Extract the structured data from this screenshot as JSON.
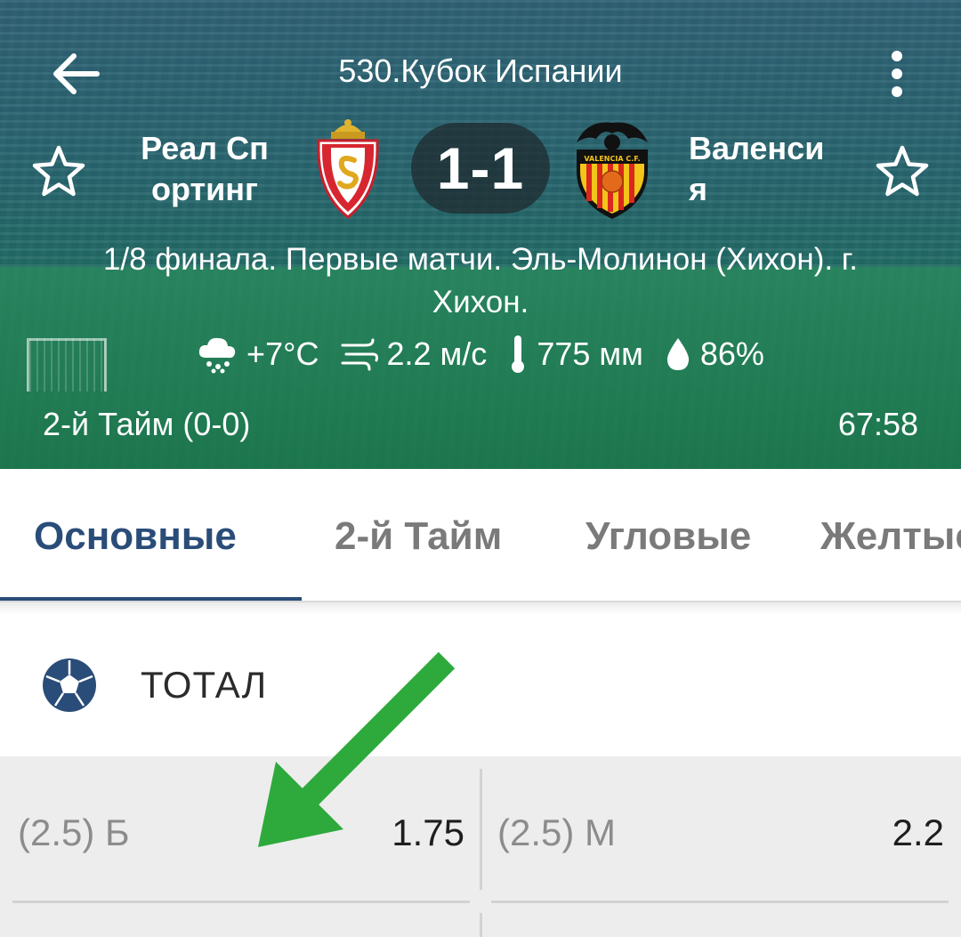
{
  "header": {
    "title": "530.Кубок Испании",
    "back_icon": "arrow-left-icon",
    "menu_icon": "more-vertical-icon",
    "home_team": {
      "name_line1": "Реал Сп",
      "name_line2": "ортинг",
      "crest": "sporting-gijon-crest"
    },
    "away_team": {
      "name_line1": "Валенси",
      "name_line2": "я",
      "crest": "valencia-cf-crest",
      "crest_text": "VALENCIA C.F."
    },
    "score": "1-1",
    "stage_line1": "1/8 финала. Первые матчи. Эль-Молинон (Хихон). г.",
    "stage_line2": "Хихон.",
    "weather": {
      "temperature": "+7°C",
      "wind": "2.2 м/с",
      "pressure": "775 мм",
      "humidity": "86%"
    },
    "period": "2-й  Тайм (0-0)",
    "clock": "67:58"
  },
  "tabs": [
    {
      "label": "Основные",
      "active": true
    },
    {
      "label": "2-й  Тайм",
      "active": false
    },
    {
      "label": "Угловые",
      "active": false
    },
    {
      "label": "Желтые",
      "active": false
    }
  ],
  "market": {
    "title": "ТОТАЛ",
    "icon": "soccer-ball-icon",
    "outcomes": [
      {
        "label": "(2.5) Б",
        "odds": "1.75"
      },
      {
        "label": "(2.5) М",
        "odds": "2.2"
      }
    ]
  },
  "colors": {
    "accent": "#2a4c78",
    "annotation_arrow": "#2eaa3c",
    "odds_background": "#ededed"
  }
}
